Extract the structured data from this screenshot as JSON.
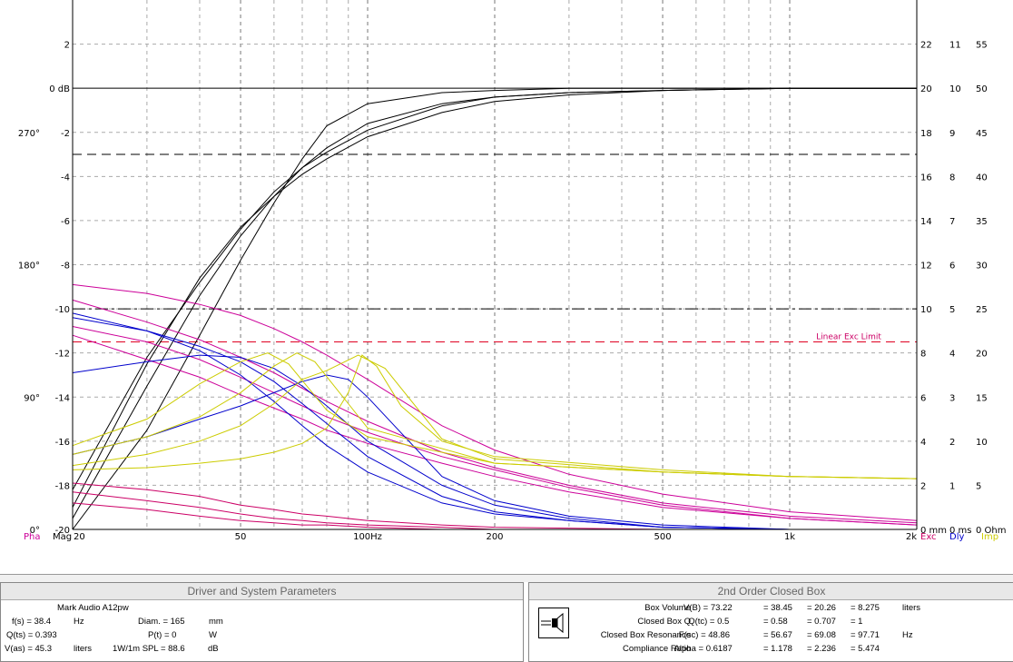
{
  "chart_data": {
    "type": "line",
    "x_scale": "log",
    "xlim": [
      20,
      2000
    ],
    "x_tick_labels": [
      {
        "v": 20,
        "t": "20"
      },
      {
        "v": 50,
        "t": "50"
      },
      {
        "v": 100,
        "t": "100Hz"
      },
      {
        "v": 200,
        "t": "200"
      },
      {
        "v": 500,
        "t": "500"
      },
      {
        "v": 1000,
        "t": "1k"
      },
      {
        "v": 2000,
        "t": "2k"
      }
    ],
    "ylim": [
      -20,
      4
    ],
    "mag_ticks": [
      {
        "v": 2,
        "t": "2"
      },
      {
        "v": 0,
        "t": "0 dB"
      },
      {
        "v": -2,
        "t": "-2"
      },
      {
        "v": -4,
        "t": "-4"
      },
      {
        "v": -6,
        "t": "-6"
      },
      {
        "v": -8,
        "t": "-8"
      },
      {
        "v": -10,
        "t": "-10"
      },
      {
        "v": -12,
        "t": "-12"
      },
      {
        "v": -14,
        "t": "-14"
      },
      {
        "v": -16,
        "t": "-16"
      },
      {
        "v": -18,
        "t": "-18"
      },
      {
        "v": -20,
        "t": "-20"
      }
    ],
    "phase_ticks": [
      {
        "v": -2,
        "t": "270°"
      },
      {
        "v": -8,
        "t": "180°"
      },
      {
        "v": -14,
        "t": "90°"
      },
      {
        "v": -20,
        "t": "0°"
      }
    ],
    "right_ticks": [
      {
        "v": 2,
        "a": "22",
        "b": "11",
        "c": "55"
      },
      {
        "v": 0,
        "a": "20",
        "b": "10",
        "c": "50"
      },
      {
        "v": -2,
        "a": "18",
        "b": "9",
        "c": "45"
      },
      {
        "v": -4,
        "a": "16",
        "b": "8",
        "c": "40"
      },
      {
        "v": -6,
        "a": "14",
        "b": "7",
        "c": "35"
      },
      {
        "v": -8,
        "a": "12",
        "b": "6",
        "c": "30"
      },
      {
        "v": -10,
        "a": "10",
        "b": "5",
        "c": "25"
      },
      {
        "v": -12,
        "a": "8",
        "b": "4",
        "c": "20"
      },
      {
        "v": -14,
        "a": "6",
        "b": "3",
        "c": "15"
      },
      {
        "v": -16,
        "a": "4",
        "b": "2",
        "c": "10"
      },
      {
        "v": -18,
        "a": "2",
        "b": "1",
        "c": "5"
      },
      {
        "v": -20,
        "a": "0 mm",
        "b": "0 ms",
        "c": "0 Ohm"
      }
    ],
    "bottom_labels": {
      "pha": "Pha",
      "mag": "Mag",
      "exc": "Exc",
      "dly": "Dly",
      "imp": "Imp"
    },
    "reference_lines": [
      {
        "y": -3,
        "style": "dashed",
        "color": "#000000"
      },
      {
        "y": -10,
        "style": "dash-dot",
        "color": "#000000"
      },
      {
        "y": -11.5,
        "style": "dashed",
        "color": "#e00020",
        "label": "Linear Exc Limit"
      }
    ],
    "colors": {
      "magnitude": "#000000",
      "phase": "#cc0099",
      "excursion": "#cc0066",
      "delay": "#0000cc",
      "impedance": "#cccc00"
    },
    "series": [
      {
        "group": "magnitude",
        "x": [
          20,
          30,
          40,
          50,
          60,
          70,
          80,
          100,
          150,
          200,
          300,
          500,
          1000,
          2000
        ],
        "y": [
          -20,
          -15.5,
          -11.2,
          -7.8,
          -5.2,
          -3.2,
          -1.7,
          -0.7,
          -0.2,
          -0.1,
          0,
          0,
          0,
          0
        ]
      },
      {
        "group": "magnitude",
        "x": [
          20,
          30,
          40,
          50,
          60,
          70,
          80,
          100,
          150,
          200,
          300,
          500,
          1000,
          2000
        ],
        "y": [
          -19.5,
          -13.5,
          -9.4,
          -6.7,
          -4.9,
          -3.6,
          -2.7,
          -1.6,
          -0.7,
          -0.4,
          -0.2,
          -0.1,
          0,
          0
        ]
      },
      {
        "group": "magnitude",
        "x": [
          20,
          30,
          40,
          50,
          60,
          70,
          80,
          100,
          150,
          200,
          300,
          500,
          1000,
          2000
        ],
        "y": [
          -19,
          -12.5,
          -8.6,
          -6.3,
          -4.9,
          -3.9,
          -3.2,
          -2.2,
          -1.1,
          -0.6,
          -0.3,
          -0.1,
          0,
          0
        ]
      },
      {
        "group": "magnitude",
        "x": [
          20,
          30,
          40,
          50,
          60,
          70,
          80,
          100,
          150,
          200,
          300,
          500,
          1000,
          2000
        ],
        "y": [
          -18.2,
          -12.2,
          -8.8,
          -6.4,
          -4.7,
          -3.6,
          -2.9,
          -1.9,
          -0.8,
          -0.4,
          -0.2,
          -0.1,
          0,
          0
        ]
      },
      {
        "group": "phase",
        "x": [
          20,
          30,
          40,
          50,
          60,
          70,
          80,
          100,
          150,
          200,
          300,
          500,
          1000,
          2000
        ],
        "y": [
          -8.9,
          -9.3,
          -9.8,
          -10.3,
          -10.9,
          -11.5,
          -12.1,
          -13.2,
          -15.3,
          -16.4,
          -17.5,
          -18.4,
          -19.2,
          -19.6
        ]
      },
      {
        "group": "phase",
        "x": [
          20,
          30,
          40,
          50,
          60,
          70,
          80,
          100,
          150,
          200,
          300,
          500,
          1000,
          2000
        ],
        "y": [
          -9.6,
          -10.6,
          -11.4,
          -12.2,
          -12.9,
          -13.6,
          -14.2,
          -15.1,
          -16.5,
          -17.2,
          -18.0,
          -18.8,
          -19.4,
          -19.7
        ]
      },
      {
        "group": "phase",
        "x": [
          20,
          30,
          40,
          50,
          60,
          70,
          80,
          100,
          150,
          200,
          300,
          500,
          1000,
          2000
        ],
        "y": [
          -10.8,
          -11.5,
          -12.3,
          -13.1,
          -13.8,
          -14.4,
          -14.9,
          -15.6,
          -16.7,
          -17.3,
          -18.1,
          -18.9,
          -19.5,
          -19.8
        ]
      },
      {
        "group": "phase",
        "x": [
          20,
          30,
          40,
          50,
          60,
          70,
          80,
          100,
          150,
          200,
          300,
          500,
          1000,
          2000
        ],
        "y": [
          -11.2,
          -12.3,
          -13.1,
          -13.9,
          -14.5,
          -15.0,
          -15.5,
          -16.1,
          -17.0,
          -17.6,
          -18.3,
          -19.0,
          -19.5,
          -19.8
        ]
      },
      {
        "group": "delay",
        "x": [
          20,
          30,
          40,
          50,
          60,
          70,
          80,
          100,
          150,
          200,
          300,
          500,
          1000
        ],
        "y": [
          -10.4,
          -11.0,
          -11.9,
          -13.0,
          -14.2,
          -15.3,
          -16.2,
          -17.4,
          -18.8,
          -19.3,
          -19.6,
          -19.9,
          -20.0
        ]
      },
      {
        "group": "delay",
        "x": [
          20,
          30,
          40,
          50,
          60,
          70,
          80,
          100,
          150,
          200,
          300,
          500,
          1000
        ],
        "y": [
          -10.2,
          -11.0,
          -11.7,
          -12.4,
          -13.3,
          -14.3,
          -15.2,
          -16.7,
          -18.5,
          -19.2,
          -19.6,
          -19.9,
          -20.0
        ]
      },
      {
        "group": "delay",
        "x": [
          20,
          30,
          40,
          50,
          60,
          70,
          80,
          100,
          150,
          200,
          300,
          500,
          1000
        ],
        "y": [
          -12.9,
          -12.4,
          -12.1,
          -12.2,
          -12.7,
          -13.5,
          -14.4,
          -16.0,
          -18.0,
          -18.9,
          -19.5,
          -19.9,
          -20.0
        ]
      },
      {
        "group": "delay",
        "x": [
          20,
          30,
          40,
          50,
          60,
          70,
          80,
          90,
          100,
          150,
          200,
          300,
          500,
          1000
        ],
        "y": [
          -16.6,
          -15.8,
          -15.0,
          -14.4,
          -13.8,
          -13.3,
          -13.0,
          -13.2,
          -14.0,
          -17.6,
          -18.7,
          -19.4,
          -19.8,
          -20.0
        ]
      },
      {
        "group": "impedance",
        "x": [
          20,
          30,
          40,
          50,
          58,
          65,
          80,
          100,
          200,
          500,
          1000,
          2000
        ],
        "y": [
          -16.2,
          -15.0,
          -13.4,
          -12.4,
          -12.0,
          -12.5,
          -14.6,
          -15.8,
          -17.0,
          -17.4,
          -17.6,
          -17.7
        ]
      },
      {
        "group": "impedance",
        "x": [
          20,
          30,
          40,
          50,
          60,
          68,
          75,
          90,
          100,
          200,
          500,
          1000,
          2000
        ],
        "y": [
          -16.6,
          -15.8,
          -14.9,
          -13.8,
          -12.6,
          -12.0,
          -12.4,
          -14.3,
          -15.4,
          -17.0,
          -17.4,
          -17.6,
          -17.7
        ]
      },
      {
        "group": "impedance",
        "x": [
          20,
          30,
          40,
          50,
          60,
          70,
          80,
          95,
          110,
          150,
          200,
          500,
          1000,
          2000
        ],
        "y": [
          -17.1,
          -16.6,
          -16.0,
          -15.3,
          -14.3,
          -13.2,
          -12.8,
          -12.1,
          -12.7,
          -15.9,
          -16.8,
          -17.4,
          -17.6,
          -17.7
        ]
      },
      {
        "group": "impedance",
        "x": [
          20,
          30,
          40,
          50,
          60,
          70,
          80,
          90,
          97,
          105,
          120,
          150,
          200,
          500,
          1000,
          2000
        ],
        "y": [
          -17.3,
          -17.2,
          -17.0,
          -16.8,
          -16.5,
          -16.1,
          -15.4,
          -13.8,
          -12.1,
          -12.6,
          -14.4,
          -16.0,
          -16.7,
          -17.3,
          -17.6,
          -17.7
        ]
      },
      {
        "group": "excursion",
        "x": [
          20,
          30,
          40,
          50,
          60,
          70,
          80,
          100,
          150,
          200,
          500,
          1000,
          2000
        ],
        "y": [
          -17.9,
          -18.2,
          -18.5,
          -18.9,
          -19.1,
          -19.3,
          -19.4,
          -19.6,
          -19.8,
          -19.9,
          -20.0,
          -20.0,
          -20.0
        ]
      },
      {
        "group": "excursion",
        "x": [
          20,
          30,
          40,
          50,
          60,
          70,
          80,
          100,
          150,
          200,
          500,
          1000,
          2000
        ],
        "y": [
          -18.3,
          -18.7,
          -19.0,
          -19.3,
          -19.5,
          -19.6,
          -19.7,
          -19.8,
          -19.9,
          -20.0,
          -20.0,
          -20.0,
          -20.0
        ]
      },
      {
        "group": "excursion",
        "x": [
          20,
          30,
          40,
          50,
          60,
          70,
          80,
          100,
          150,
          200,
          500,
          1000,
          2000
        ],
        "y": [
          -18.8,
          -19.1,
          -19.4,
          -19.6,
          -19.7,
          -19.8,
          -19.8,
          -19.9,
          -20.0,
          -20.0,
          -20.0,
          -20.0,
          -20.0
        ]
      }
    ]
  },
  "driver_panel": {
    "title": "Driver and System Parameters",
    "model": "Mark Audio  A12pw",
    "fs_label": "f(s) = 38.4",
    "fs_unit": "Hz",
    "qts_label": "Q(ts) = 0.393",
    "vas_label": "V(as) = 45.3",
    "vas_unit": "liters",
    "diam_label": "Diam. = 165",
    "diam_unit": "mm",
    "pt_label": "P(t) = 0",
    "pt_unit": "W",
    "spl_label": "1W/1m SPL = 88.6",
    "spl_unit": "dB"
  },
  "box_panel": {
    "title": "2nd Order Closed Box",
    "rows": [
      {
        "label": "Box Volume",
        "vals": [
          "V(B) = 73.22",
          "= 38.45",
          "= 20.26",
          "= 8.275"
        ],
        "unit": "liters"
      },
      {
        "label": "Closed Box Q",
        "vals": [
          "Q(tc) = 0.5",
          "= 0.58",
          "= 0.707",
          "= 1"
        ],
        "unit": ""
      },
      {
        "label": "Closed Box Resonance",
        "vals": [
          "F(sc) = 48.86",
          "= 56.67",
          "= 69.08",
          "= 97.71"
        ],
        "unit": "Hz"
      },
      {
        "label": "Compliance Ratio",
        "vals": [
          "Alpha = 0.6187",
          "= 1.178",
          "= 2.236",
          "= 5.474"
        ],
        "unit": ""
      }
    ]
  }
}
